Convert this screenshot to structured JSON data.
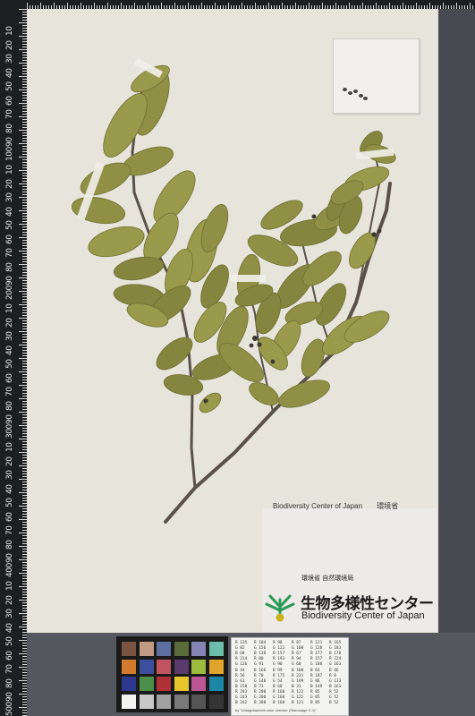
{
  "ruler": {
    "labels": [
      "10",
      "20",
      "30",
      "40",
      "50",
      "60",
      "70",
      "80",
      "90",
      "100",
      "10",
      "20",
      "30",
      "40",
      "50",
      "60",
      "70",
      "80",
      "90",
      "200",
      "10",
      "20",
      "30",
      "40",
      "50",
      "60",
      "70",
      "80",
      "90",
      "300",
      "10",
      "20",
      "30",
      "40",
      "50",
      "60",
      "70",
      "80",
      "90",
      "400",
      "10",
      "20",
      "30",
      "40",
      "50",
      "60",
      "70",
      "80",
      "90",
      "500",
      "10",
      "20"
    ]
  },
  "label_top": {
    "left_text": "Biodiversity Center of Japan",
    "right_text": "環境省"
  },
  "center": {
    "ministry": "環境省 自然環境局",
    "name_jp": "生物多様性センター",
    "name_en": "Biodiversity Center of Japan"
  },
  "gray_card": {
    "rows": [
      [
        "R 135",
        "R 104",
        "R 98",
        "R 87",
        "R 121",
        "R 165"
      ],
      [
        "G 82",
        "G 156",
        "G 122",
        "G 108",
        "G 128",
        "G 183"
      ],
      [
        "B 68",
        "B 130",
        "B 157",
        "B 67",
        "B 177",
        "B 170"
      ],
      [
        "R 214",
        "R 80",
        "R 193",
        "R 94",
        "R 157",
        "R 224"
      ],
      [
        "G 126",
        "G 91",
        "G 90",
        "G 60",
        "G 188",
        "G 163"
      ],
      [
        "B 44",
        "B 166",
        "B 99",
        "B 108",
        "B 64",
        "B 46"
      ],
      [
        "R 56",
        "R 70",
        "R 175",
        "R 231",
        "R 187",
        "R 8"
      ],
      [
        "G 61",
        "G 148",
        "G 54",
        "G 199",
        "G 86",
        "G 133"
      ],
      [
        "B 150",
        "B 73",
        "B 60",
        "B 31",
        "B 149",
        "B 161"
      ],
      [
        "R 243",
        "R 200",
        "R 160",
        "R 122",
        "R 85",
        "R 52"
      ],
      [
        "G 243",
        "G 200",
        "G 160",
        "G 122",
        "G 85",
        "G 52"
      ],
      [
        "B 242",
        "B 200",
        "B 160",
        "B 121",
        "B 85",
        "B 52"
      ]
    ],
    "footer": "by \"Untaghbacheth color checker  (Stammage C-1)\""
  },
  "colors": {
    "sheet": "#e7e4dc",
    "leaf": "#8f9045",
    "leaf_dark": "#6f7032",
    "stem": "#5a5148",
    "logo_green": "#2a9a55",
    "logo_yellow": "#c9b21c",
    "color_checker": [
      "#7a5442",
      "#c39a84",
      "#5c6f9e",
      "#5b6c3a",
      "#8583b4",
      "#6cbda9",
      "#d27a2e",
      "#3e4f9d",
      "#c1545f",
      "#5a3a6b",
      "#9dbb3f",
      "#e1a52d",
      "#30378f",
      "#4b8f4a",
      "#af3035",
      "#e7c62d",
      "#bb5694",
      "#1d86a7",
      "#f3f3f1",
      "#c8c8c8",
      "#a0a0a0",
      "#7a7a7a",
      "#555555",
      "#343434"
    ]
  }
}
